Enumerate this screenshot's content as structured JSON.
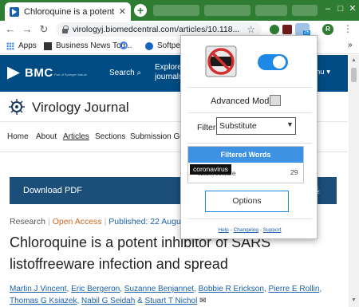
{
  "browser": {
    "active_tab_title": "Chloroquine is a potent inhibitor of SARS",
    "tab_close": "✕",
    "new_tab": "+",
    "url": "virologyj.biomedcentral.com/articles/10.118...",
    "bookmarks": [
      "Apps",
      "Business News Tod...",
      "G",
      "Softpedia"
    ],
    "avatar_letter": "R",
    "extension_badge": "25",
    "window_controls": [
      "–",
      "□",
      "✕"
    ],
    "nav": [
      "←",
      "→",
      "↻"
    ],
    "star": "☆",
    "menu": "⋮",
    "more_bookmarks": "»"
  },
  "site": {
    "brand": "BMC",
    "brand_sub": "Part of Springer Nature",
    "search_label": "Search",
    "explore_label": "Explore journals",
    "menu_label": "nu ▾",
    "journal_title": "Virology Journal",
    "nav": [
      "Home",
      "About",
      "Articles",
      "Sections",
      "Submission Guidelines"
    ],
    "download_pdf": "Download PDF",
    "download_icon": "⤓",
    "meta": {
      "type": "Research",
      "access": "Open Access",
      "published": "Published: 22 August 2005"
    },
    "article_title": "Chloroquine is a potent inhibitor of SARS listoffreeware infection and spread",
    "authors_line1": [
      "Martin J Vincent",
      "Eric Bergeron",
      "Suzanne Benjannet",
      "Bobbie R Erickson",
      "Pierre E Rollin"
    ],
    "authors_line2": [
      "Thomas G Ksiazek",
      "Nabil G Seidah",
      "Stuart T Nichol"
    ],
    "mail_icon": "✉"
  },
  "popup": {
    "enabled": true,
    "advanced_mode_label": "Advanced Mode",
    "advanced_mode_checked": false,
    "filter_label": "Filter",
    "filter_value": "Substitute",
    "filtered_words_header": "Filtered Words",
    "words": [
      {
        "word": "listoffreeware",
        "count": "29"
      }
    ],
    "tooltip": "coronavirus",
    "options_label": "Options",
    "footer": [
      "Help",
      "Changelog",
      "Support"
    ],
    "colors": {
      "accent": "#1e88e5",
      "header": "#3d92e3"
    }
  }
}
